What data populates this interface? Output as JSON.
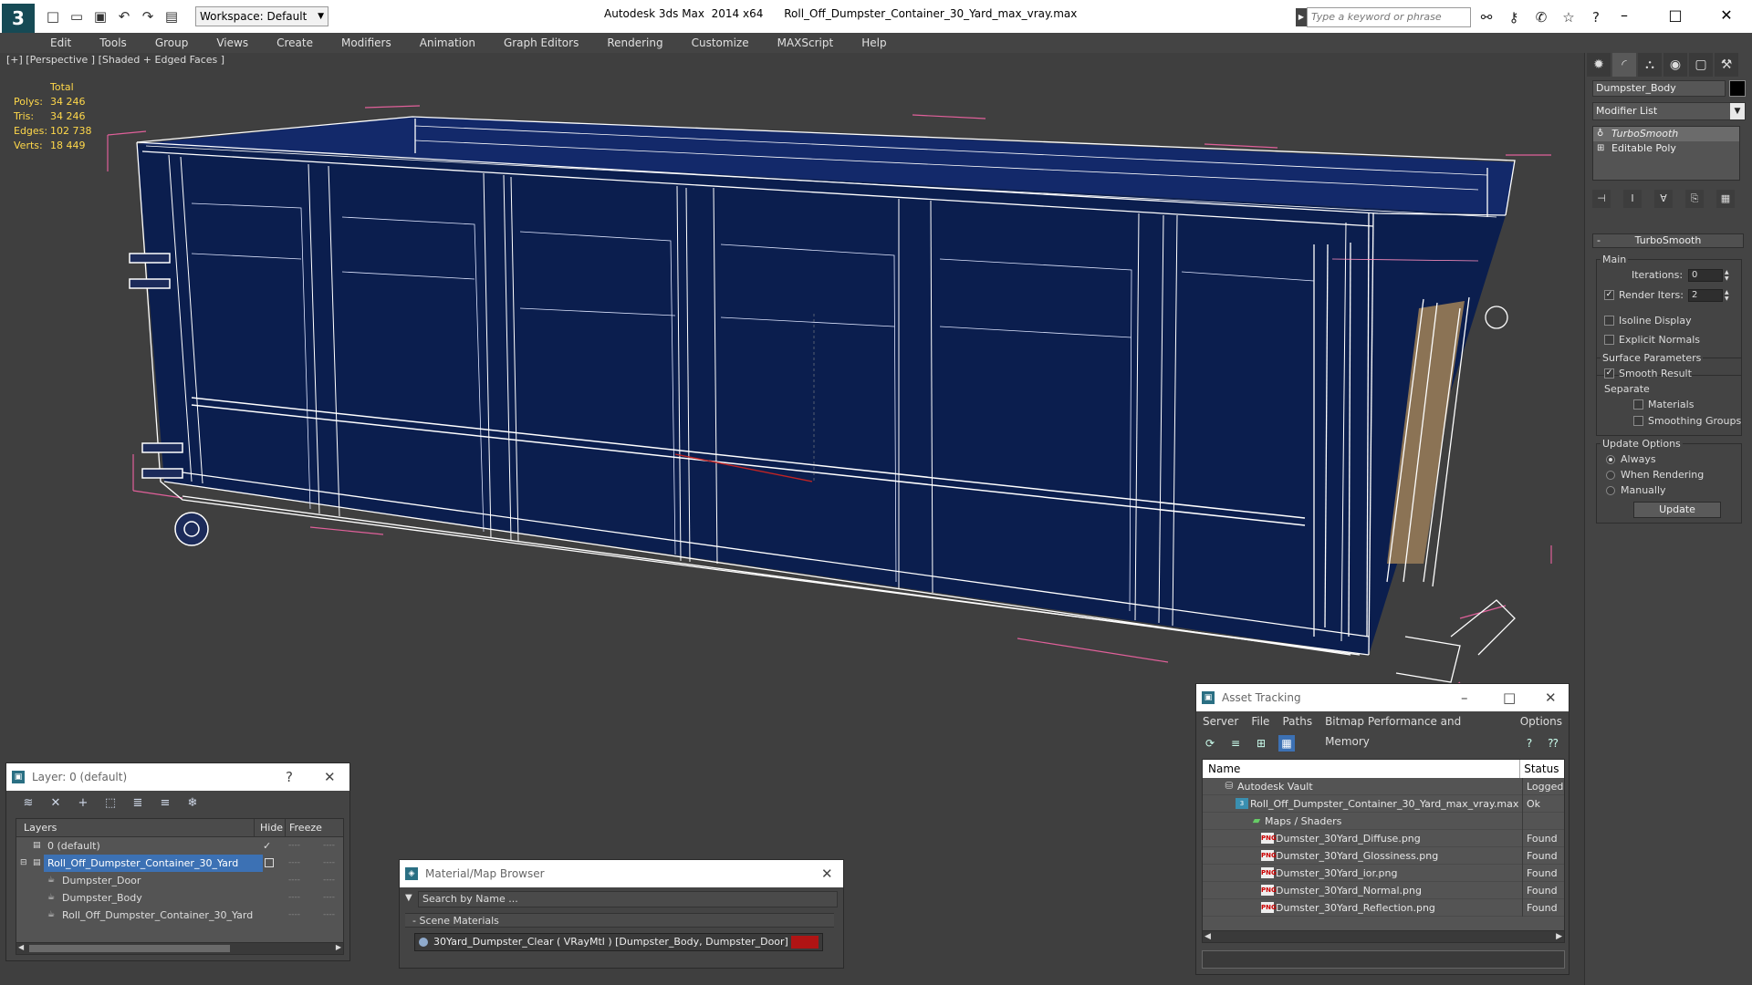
{
  "titlebar": {
    "app_title": "Autodesk 3ds Max  2014 x64",
    "file_name": "Roll_Off_Dumpster_Container_30_Yard_max_vray.max",
    "workspace": "Workspace: Default",
    "search_placeholder": "Type a keyword or phrase",
    "logo": "3"
  },
  "menu": [
    "Edit",
    "Tools",
    "Group",
    "Views",
    "Create",
    "Modifiers",
    "Animation",
    "Graph Editors",
    "Rendering",
    "Customize",
    "MAXScript",
    "Help"
  ],
  "viewport": {
    "label": "[+] [Perspective ] [Shaded + Edged Faces ]",
    "stats": {
      "header": "Total",
      "polys_label": "Polys:",
      "polys": "34 246",
      "tris_label": "Tris:",
      "tris": "34 246",
      "edges_label": "Edges:",
      "edges": "102 738",
      "verts_label": "Verts:",
      "verts": "18 449"
    }
  },
  "command_panel": {
    "object_name": "Dumpster_Body",
    "modifier_list": "Modifier List",
    "stack": [
      "TurboSmooth",
      "Editable Poly"
    ],
    "rollout_title": "TurboSmooth",
    "main_group": "Main",
    "iterations_label": "Iterations:",
    "iterations_value": "0",
    "render_iters_label": "Render Iters:",
    "render_iters_value": "2",
    "render_iters_checked": true,
    "isoline_label": "Isoline Display",
    "explicit_normals_label": "Explicit Normals",
    "surface_group": "Surface Parameters",
    "smooth_result_label": "Smooth Result",
    "smooth_result_checked": true,
    "separate_label": "Separate",
    "materials_label": "Materials",
    "smoothing_groups_label": "Smoothing Groups",
    "update_group": "Update Options",
    "always_label": "Always",
    "when_rendering_label": "When Rendering",
    "manually_label": "Manually",
    "update_button": "Update"
  },
  "layer_window": {
    "title": "Layer: 0 (default)",
    "help": "?",
    "col_layers": "Layers",
    "col_hide": "Hide",
    "col_freeze": "Freeze",
    "rows": [
      {
        "name": "0 (default)",
        "indent": 0,
        "selected": false,
        "check": "✓"
      },
      {
        "name": "Roll_Off_Dumpster_Container_30_Yard",
        "indent": 0,
        "selected": true,
        "check": ""
      },
      {
        "name": "Dumpster_Door",
        "indent": 1,
        "selected": false,
        "check": ""
      },
      {
        "name": "Dumpster_Body",
        "indent": 1,
        "selected": false,
        "check": ""
      },
      {
        "name": "Roll_Off_Dumpster_Container_30_Yard",
        "indent": 1,
        "selected": false,
        "check": ""
      }
    ]
  },
  "material_browser": {
    "title": "Material/Map Browser",
    "search": "Search by Name ...",
    "section": "- Scene Materials",
    "item": "30Yard_Dumpster_Clear  ( VRayMtl ) [Dumpster_Body, Dumpster_Door]",
    "swatch_color": "#b01414"
  },
  "asset_tracking": {
    "title": "Asset Tracking",
    "menu": [
      "Server",
      "File",
      "Paths",
      "Bitmap Performance and Memory",
      "Options"
    ],
    "col_name": "Name",
    "col_status": "Status",
    "rows": [
      {
        "name": "Autodesk Vault",
        "status": "Logged Out",
        "indent": 1,
        "icon": "vault"
      },
      {
        "name": "Roll_Off_Dumpster_Container_30_Yard_max_vray.max",
        "status": "Ok",
        "indent": 2,
        "icon": "file"
      },
      {
        "name": "Maps / Shaders",
        "status": "",
        "indent": 3,
        "icon": "maps"
      },
      {
        "name": "Dumster_30Yard_Diffuse.png",
        "status": "Found",
        "indent": 4,
        "icon": "png"
      },
      {
        "name": "Dumster_30Yard_Glossiness.png",
        "status": "Found",
        "indent": 4,
        "icon": "png"
      },
      {
        "name": "Dumster_30Yard_ior.png",
        "status": "Found",
        "indent": 4,
        "icon": "png"
      },
      {
        "name": "Dumster_30Yard_Normal.png",
        "status": "Found",
        "indent": 4,
        "icon": "png"
      },
      {
        "name": "Dumster_30Yard_Reflection.png",
        "status": "Found",
        "indent": 4,
        "icon": "png"
      }
    ]
  }
}
